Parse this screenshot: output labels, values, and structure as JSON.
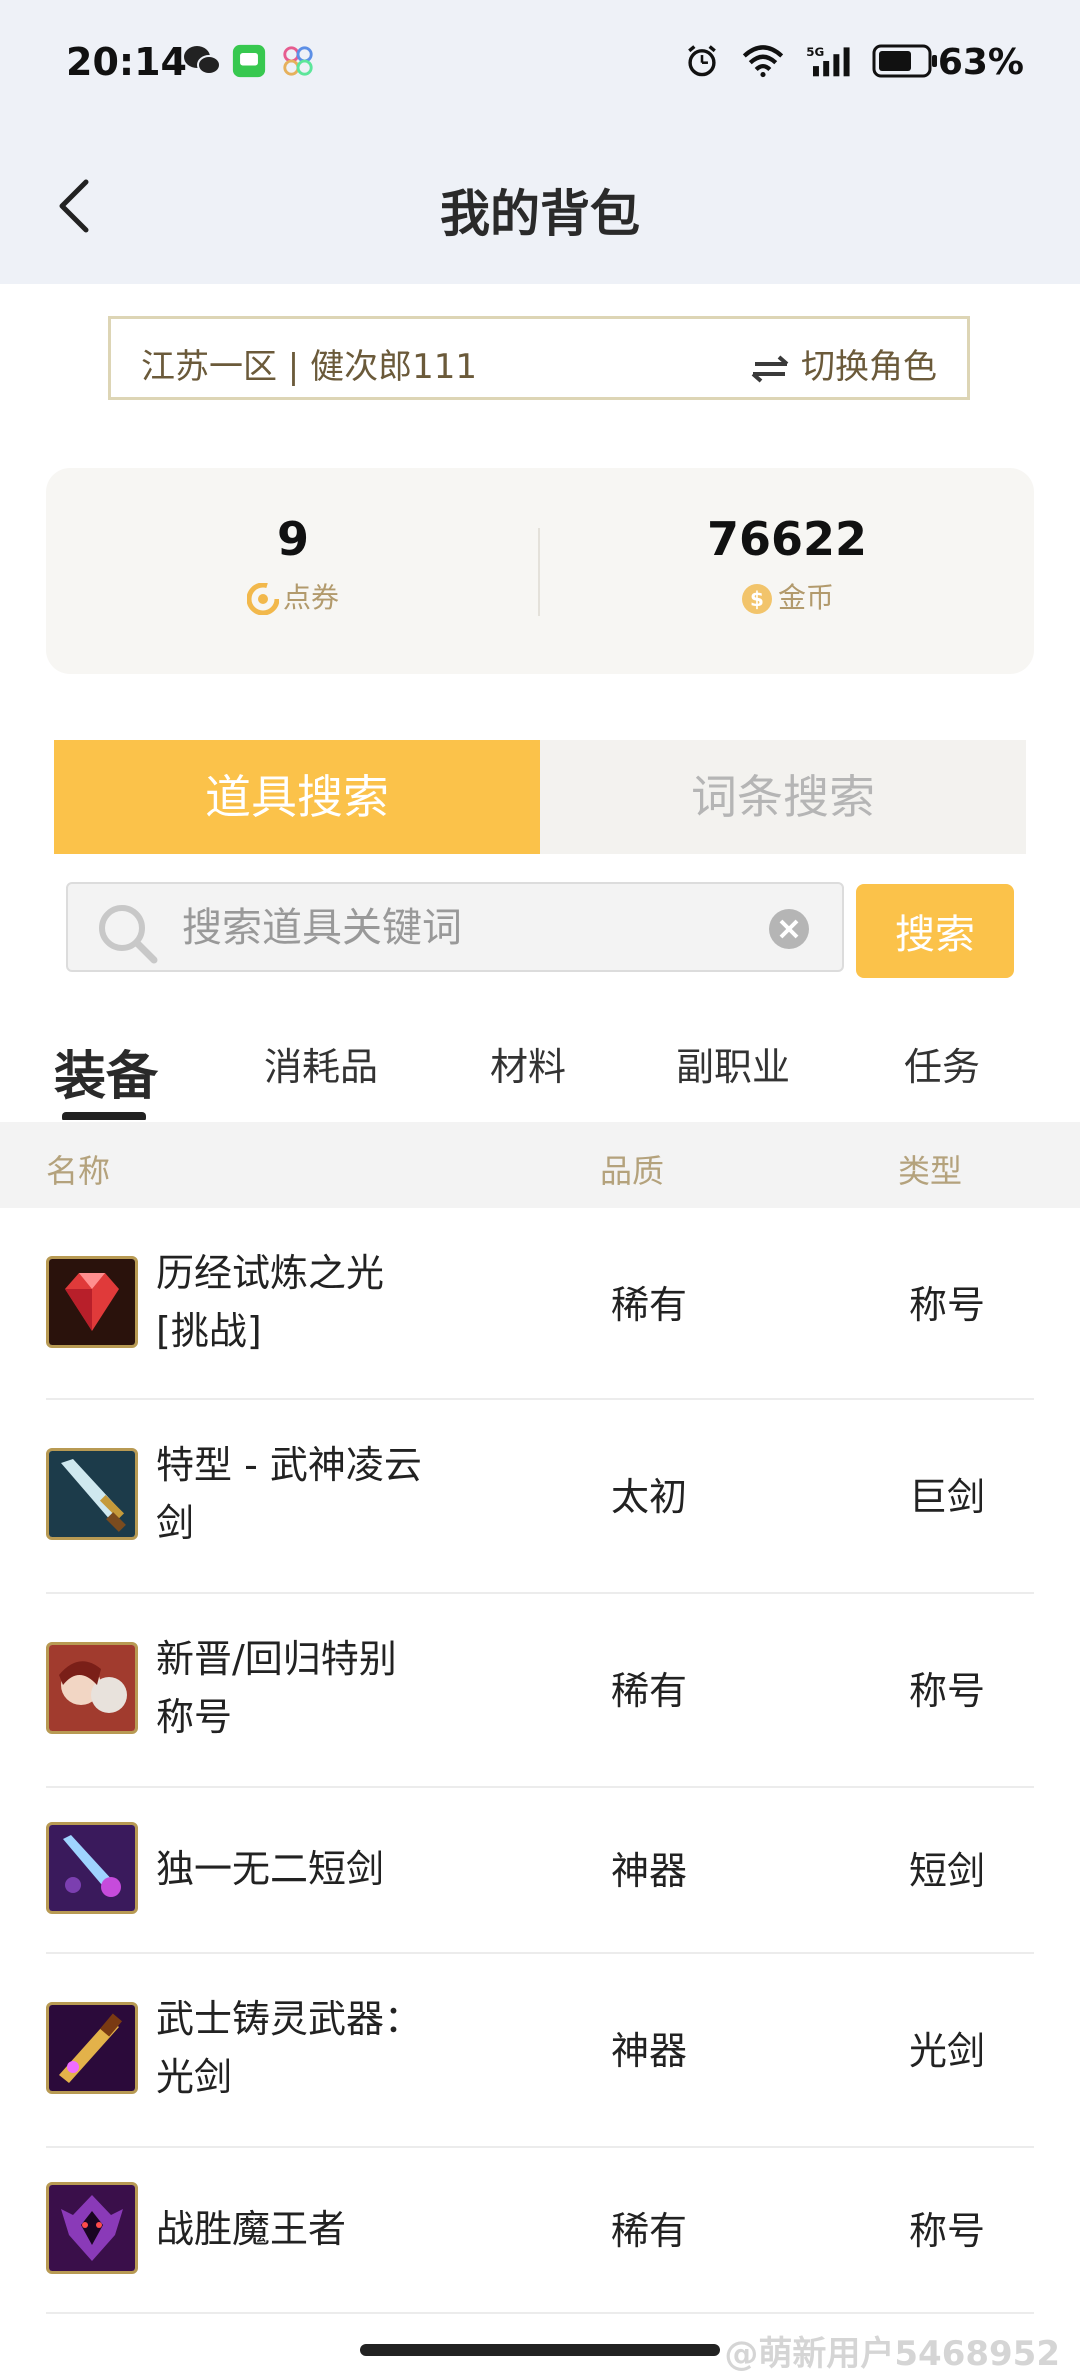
{
  "status_bar": {
    "time": "20:14",
    "battery_pct": "63%",
    "network": "5G"
  },
  "nav": {
    "title": "我的背包"
  },
  "role": {
    "name": "江苏一区 | 健次郎111",
    "switch_label": "切换角色"
  },
  "stats": {
    "points_value": "9",
    "points_label": "点券",
    "gold_value": "76622",
    "gold_label": "金币"
  },
  "tabs": {
    "items": [
      "道具搜索",
      "词条搜索"
    ],
    "active": 0
  },
  "search": {
    "placeholder": "搜索道具关键词",
    "button_label": "搜索"
  },
  "categories": {
    "items": [
      "装备",
      "消耗品",
      "材料",
      "副职业",
      "任务"
    ],
    "active": 0
  },
  "table": {
    "headers": [
      "名称",
      "品质",
      "类型"
    ],
    "rows": [
      {
        "name": "历经试炼之光\n[挑战]",
        "quality": "稀有",
        "type": "称号",
        "icon": "red-gem-icon"
      },
      {
        "name": "特型 - 武神凌云\n剑",
        "quality": "太初",
        "type": "巨剑",
        "icon": "greatsword-icon"
      },
      {
        "name": "新晋/回归特别\n称号",
        "quality": "稀有",
        "type": "称号",
        "icon": "character-portrait-icon"
      },
      {
        "name": "独一无二短剑",
        "quality": "神器",
        "type": "短剑",
        "icon": "dagger-icon"
      },
      {
        "name": "武士铸灵武器：\n光剑",
        "quality": "神器",
        "type": "光剑",
        "icon": "lightsaber-icon"
      },
      {
        "name": "战胜魔王者",
        "quality": "稀有",
        "type": "称号",
        "icon": "demon-crest-icon"
      }
    ]
  },
  "watermark": "@萌新用户5468952",
  "colors": {
    "accent": "#fbc24a",
    "nav_bg": "#eef1f7",
    "label_brown": "#b4a27c"
  }
}
